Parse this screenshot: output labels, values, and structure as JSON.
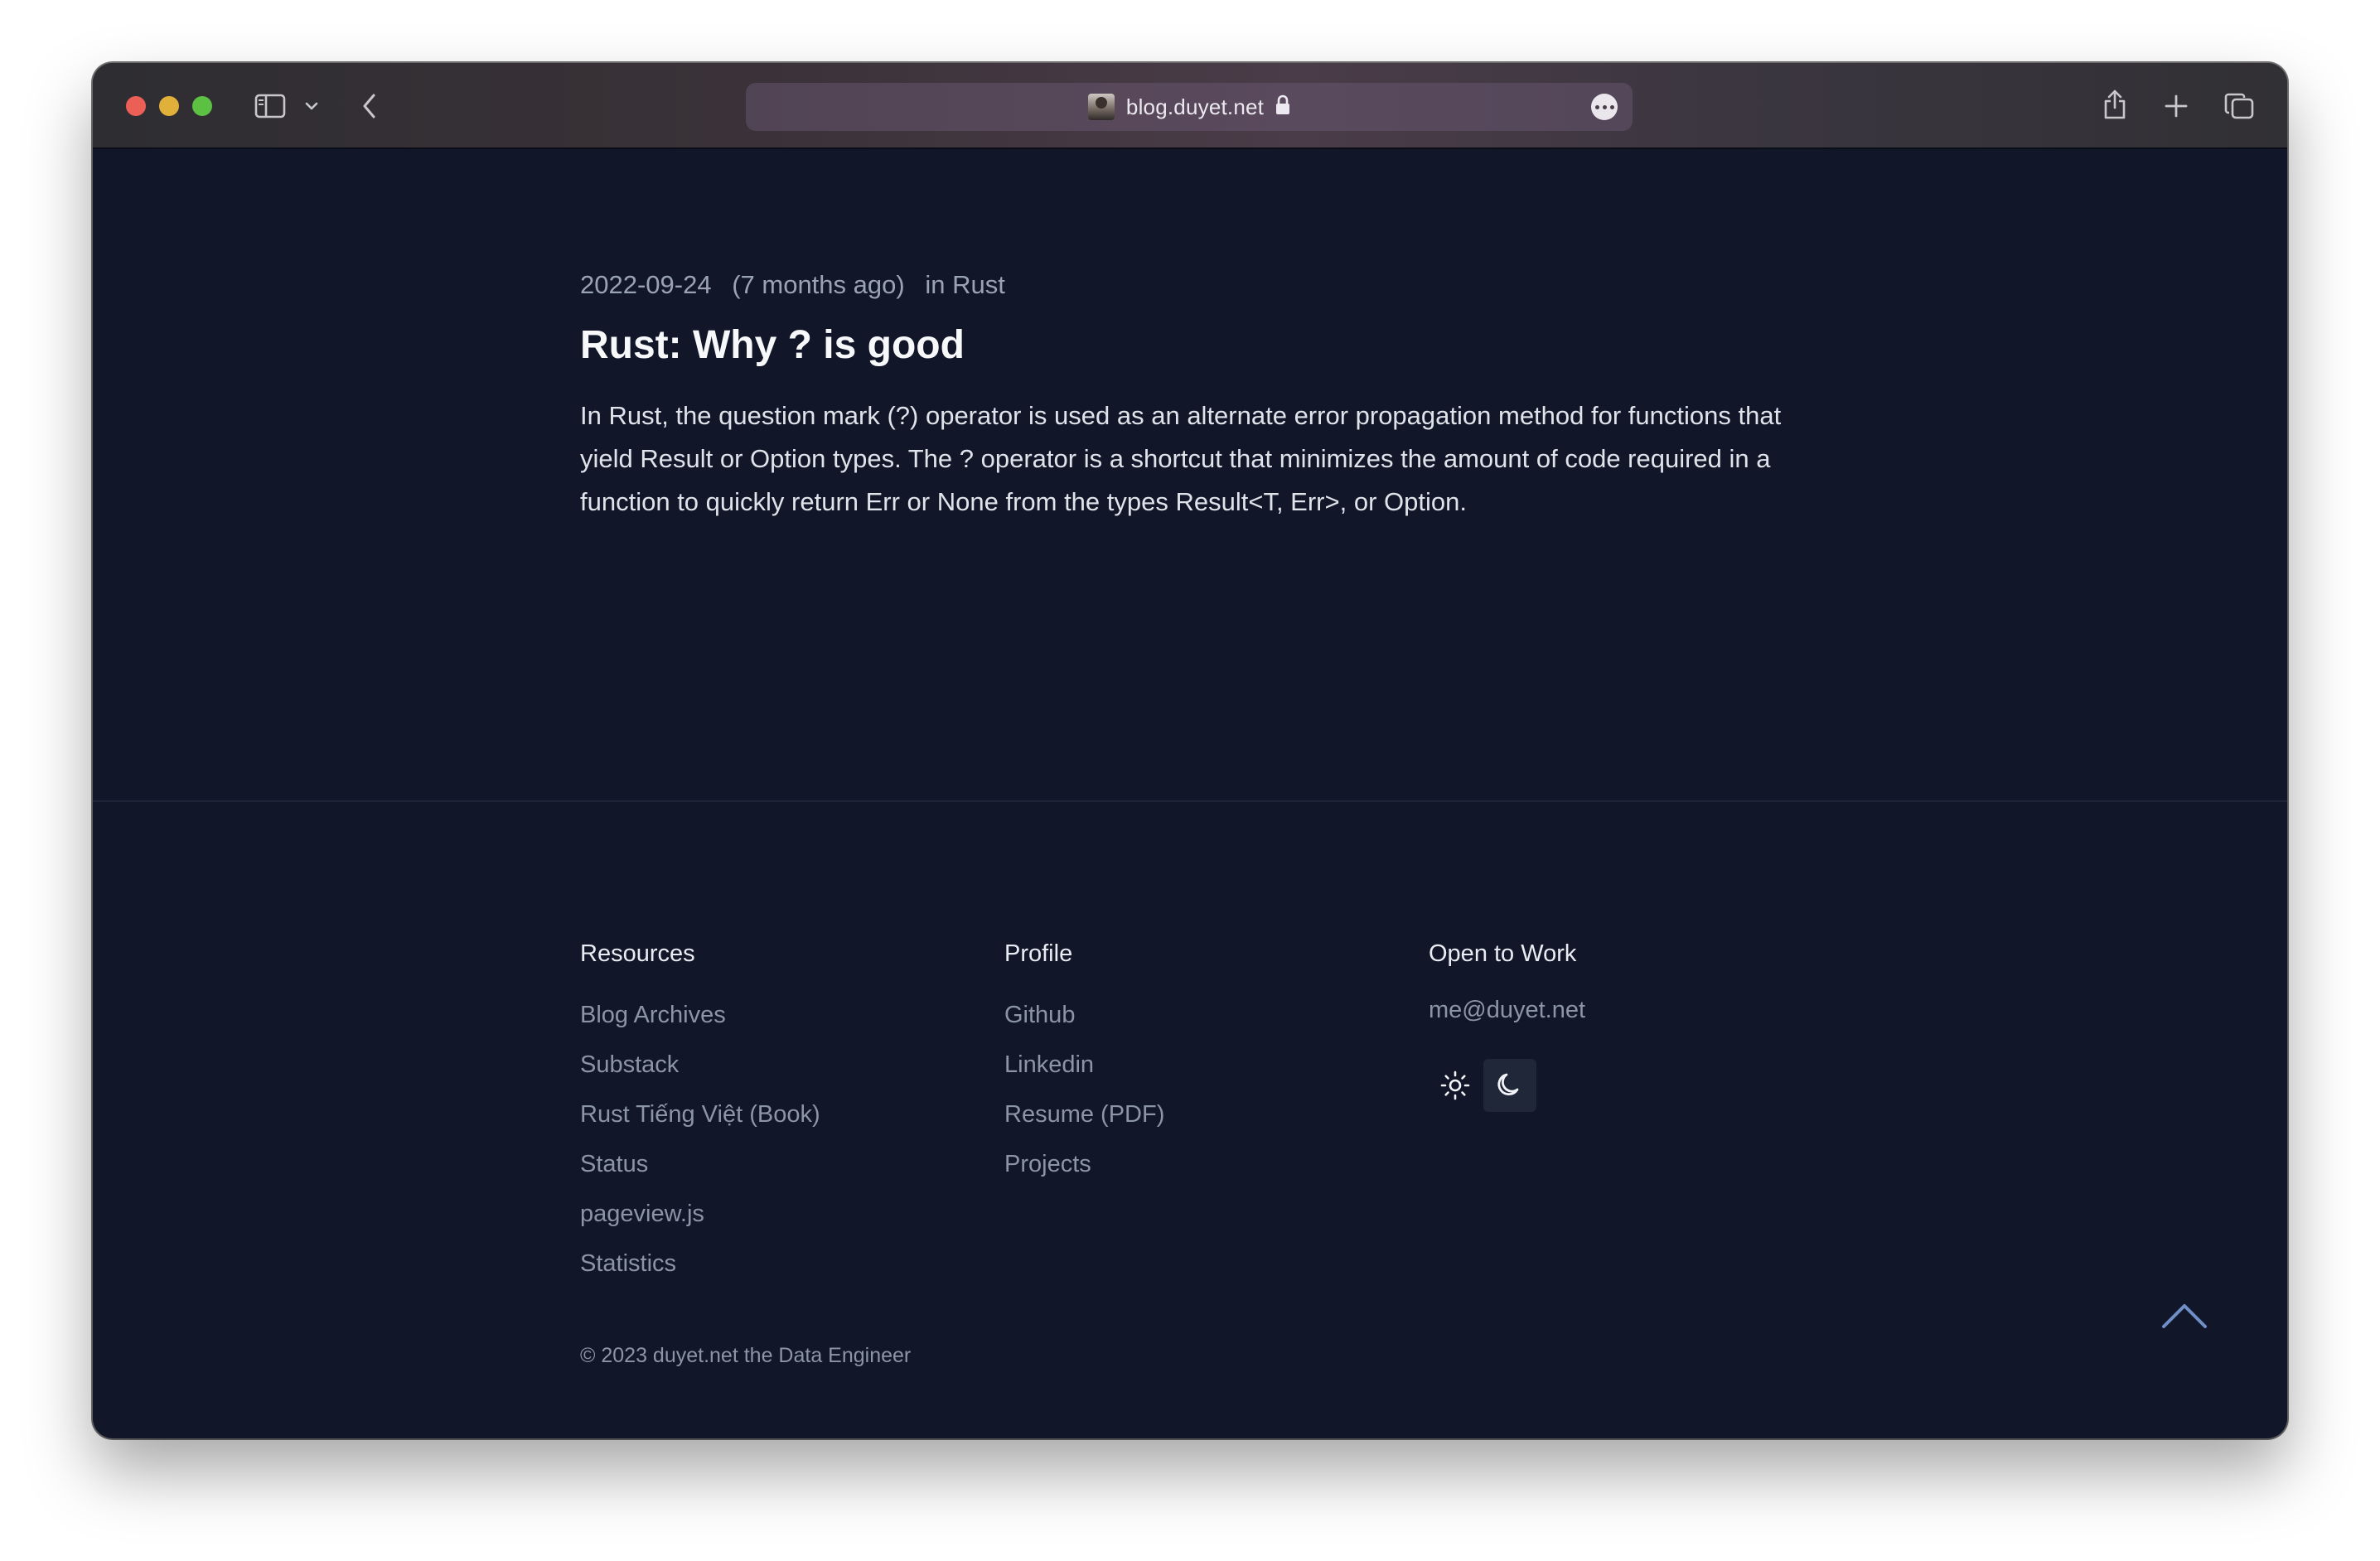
{
  "browser": {
    "url": "blog.duyet.net"
  },
  "post": {
    "date": "2022-09-24",
    "relative_date": "(7 months ago)",
    "category": "in Rust",
    "title": "Rust: Why ? is good",
    "excerpt": "In Rust, the question mark (?) operator is used as an alternate error propagation method for functions that yield Result or Option types. The ? operator is a shortcut that minimizes the amount of code required in a function to quickly return Err or None from the types Result<T, Err>, or Option."
  },
  "footer": {
    "resources": {
      "heading": "Resources",
      "links": [
        "Blog Archives",
        "Substack",
        "Rust Tiếng Việt (Book)",
        "Status",
        "pageview.js",
        "Statistics"
      ]
    },
    "profile": {
      "heading": "Profile",
      "links": [
        "Github",
        "Linkedin",
        "Resume (PDF)",
        "Projects"
      ]
    },
    "work": {
      "heading": "Open to Work",
      "email": "me@duyet.net"
    },
    "theme": {
      "icons": [
        "sun-icon",
        "moon-icon"
      ],
      "active": "dark"
    },
    "copyright": "© 2023 duyet.net the Data Engineer"
  },
  "colors": {
    "page_background": "#111729",
    "heading_text": "#f7f8fa",
    "link_text": "#8c95a6"
  }
}
